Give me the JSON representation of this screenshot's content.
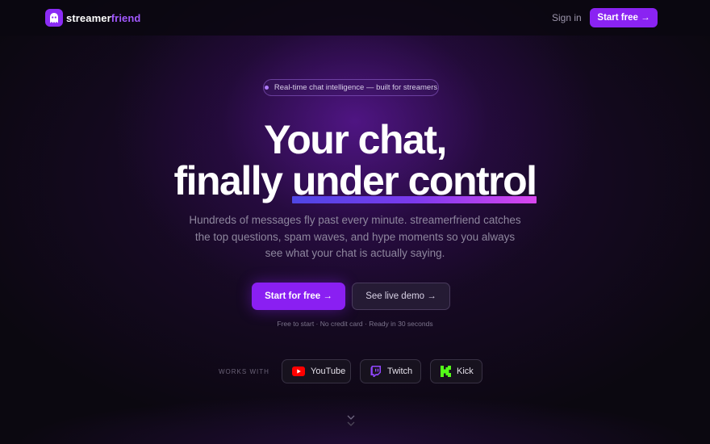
{
  "nav": {
    "brand_part1": "streamer",
    "brand_part2": "friend",
    "sign_in": "Sign in",
    "cta": "Start free →"
  },
  "hero": {
    "badge": "Real-time chat intelligence — built for streamers",
    "headline_line1": "Your chat,",
    "headline_line2_prefix": "finally ",
    "headline_highlight": "under control",
    "subtext": "Hundreds of messages fly past every minute. streamerfriend catches the top questions, spam waves, and hype moments so you always see what your chat is actually saying.",
    "primary_button": "Start for free →",
    "secondary_button": "See live demo →",
    "fine_print": "Free to start · No credit card · Ready in 30 seconds"
  },
  "works_with": {
    "label": "WORKS WITH",
    "platforms": [
      {
        "name": "YouTube",
        "icon": "youtube-icon",
        "color": "#ff0000"
      },
      {
        "name": "Twitch",
        "icon": "twitch-icon",
        "color": "#9146ff"
      },
      {
        "name": "Kick",
        "icon": "kick-icon",
        "color": "#53fc18"
      }
    ]
  },
  "colors": {
    "accent": "#8a23f2",
    "brand_secondary": "#a259ff",
    "background": "#0b0810"
  }
}
